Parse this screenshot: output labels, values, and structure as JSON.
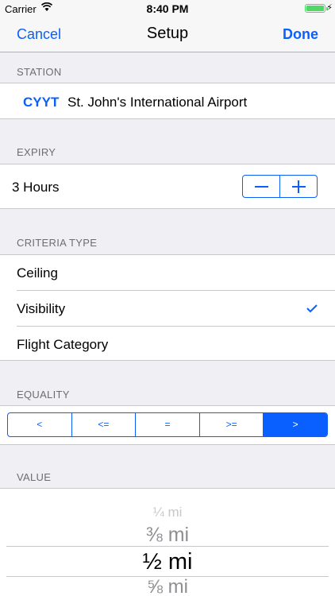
{
  "status_bar": {
    "carrier": "Carrier",
    "time": "8:40 PM",
    "battery_level": 1.0,
    "charging_icon": "bolt-icon",
    "colors": {
      "battery": "#4cd964"
    }
  },
  "nav": {
    "cancel_label": "Cancel",
    "title": "Setup",
    "done_label": "Done"
  },
  "station": {
    "header": "STATION",
    "code": "CYYT",
    "name": "St. John's International Airport"
  },
  "expiry": {
    "header": "EXPIRY",
    "value": "3 Hours",
    "minus_icon": "minus-icon",
    "plus_icon": "plus-icon"
  },
  "criteria": {
    "header": "CRITERIA TYPE",
    "options": [
      {
        "label": "Ceiling",
        "selected": false
      },
      {
        "label": "Visibility",
        "selected": true
      },
      {
        "label": "Flight Category",
        "selected": false
      }
    ]
  },
  "equality": {
    "header": "EQUALITY",
    "options": [
      "<",
      "<=",
      "=",
      ">=",
      ">"
    ],
    "selected_index": 4
  },
  "value": {
    "header": "VALUE",
    "picker_options": [
      "¼ mi",
      "⅜ mi",
      "½ mi",
      "⅝ mi"
    ],
    "selected": "½ mi"
  },
  "colors": {
    "accent": "#0a60ff",
    "background": "#efeff4",
    "section_header": "#6d6d72"
  }
}
